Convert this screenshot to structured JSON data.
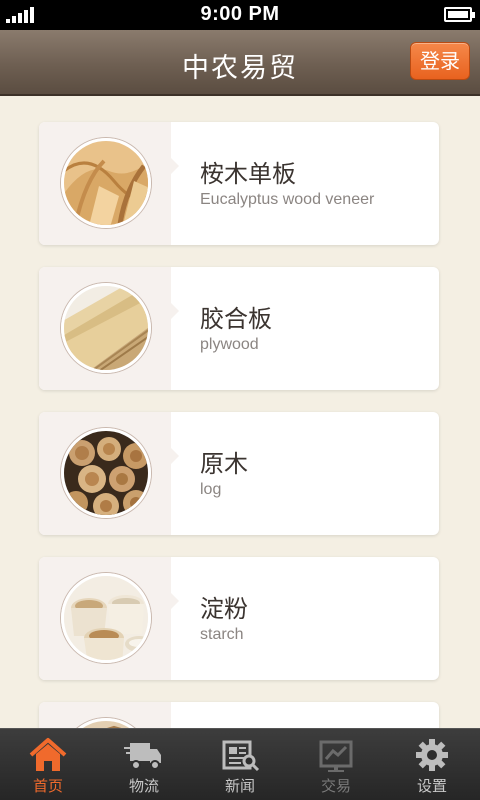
{
  "status_bar": {
    "time": "9:00 PM"
  },
  "header": {
    "title": "中农易贸",
    "login_label": "登录"
  },
  "categories": [
    {
      "name": "桉木单板",
      "sub": "Eucalyptus wood veneer",
      "icon": "veneer-image"
    },
    {
      "name": "胶合板",
      "sub": "plywood",
      "icon": "plywood-image"
    },
    {
      "name": "原木",
      "sub": "log",
      "icon": "log-image"
    },
    {
      "name": "淀粉",
      "sub": "starch",
      "icon": "starch-image"
    },
    {
      "name": "",
      "sub": "",
      "icon": "partial-image"
    }
  ],
  "tabs": [
    {
      "label": "首页",
      "icon": "home-icon",
      "state": "active"
    },
    {
      "label": "物流",
      "icon": "truck-icon",
      "state": "normal"
    },
    {
      "label": "新闻",
      "icon": "news-icon",
      "state": "normal"
    },
    {
      "label": "交易",
      "icon": "trade-icon",
      "state": "disabled"
    },
    {
      "label": "设置",
      "icon": "gear-icon",
      "state": "normal"
    }
  ],
  "colors": {
    "accent": "#f06a2c",
    "navbar": "#6e5f52",
    "background": "#f4efe3"
  }
}
